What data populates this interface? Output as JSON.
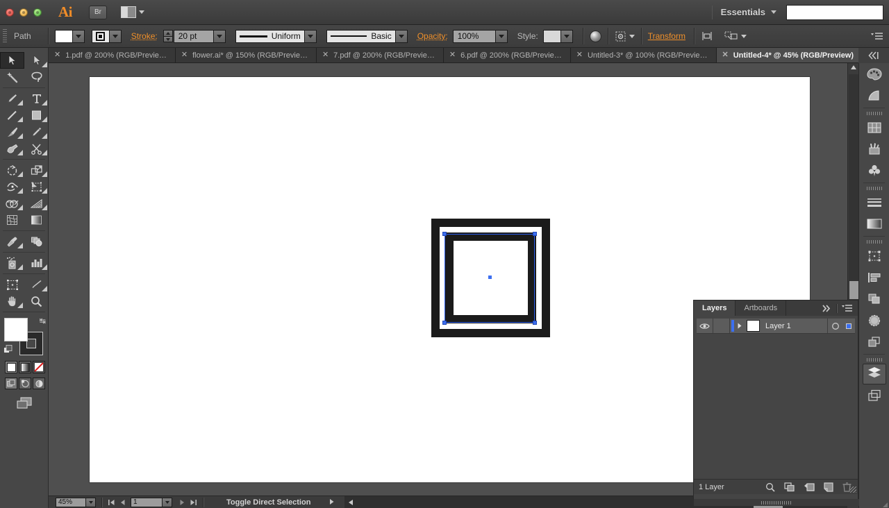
{
  "app": {
    "name": "Ai",
    "bridge_label": "Br",
    "workspace": "Essentials",
    "search_value": ""
  },
  "window_controls": [
    "close",
    "minimize",
    "zoom"
  ],
  "control_bar": {
    "object_type": "Path",
    "fill_color": "#ffffff",
    "stroke_label": "Stroke:",
    "stroke_weight": "20 pt",
    "profile": "Uniform",
    "brush": "Basic",
    "opacity_label": "Opacity:",
    "opacity_value": "100%",
    "style_label": "Style:",
    "transform_label": "Transform",
    "icons": [
      "stroke-appearance-icon",
      "opacity-appearance-icon",
      "style-swatch",
      "align-icon",
      "transform-icon",
      "isolate-icon",
      "select-similar-icon",
      "panel-menu-icon"
    ]
  },
  "tabs": [
    {
      "label": "1.pdf @ 200% (RGB/Previe…",
      "active": false
    },
    {
      "label": "flower.ai* @ 150% (RGB/Previe…",
      "active": false
    },
    {
      "label": "7.pdf @ 200% (RGB/Previe…",
      "active": false
    },
    {
      "label": "6.pdf @ 200% (RGB/Previe…",
      "active": false
    },
    {
      "label": "Untitled-3* @ 100% (RGB/Previe…",
      "active": false
    },
    {
      "label": "Untitled-4* @ 45% (RGB/Preview)",
      "active": true
    }
  ],
  "toolbar": {
    "tools": [
      {
        "name": "selection-tool",
        "selected": true,
        "flyout": false
      },
      {
        "name": "direct-selection-tool",
        "selected": false,
        "flyout": true
      },
      {
        "name": "magic-wand-tool",
        "selected": false,
        "flyout": false
      },
      {
        "name": "lasso-tool",
        "selected": false,
        "flyout": false
      },
      {
        "name": "pen-tool",
        "selected": false,
        "flyout": true
      },
      {
        "name": "type-tool",
        "selected": false,
        "flyout": true
      },
      {
        "name": "line-segment-tool",
        "selected": false,
        "flyout": true
      },
      {
        "name": "rectangle-tool",
        "selected": false,
        "flyout": true
      },
      {
        "name": "paintbrush-tool",
        "selected": false,
        "flyout": true
      },
      {
        "name": "pencil-tool",
        "selected": false,
        "flyout": true
      },
      {
        "name": "blob-brush-tool",
        "selected": false,
        "flyout": true
      },
      {
        "name": "eraser-tool",
        "selected": false,
        "flyout": true
      },
      {
        "name": "rotate-tool",
        "selected": false,
        "flyout": true
      },
      {
        "name": "scale-tool",
        "selected": false,
        "flyout": true
      },
      {
        "name": "width-tool",
        "selected": false,
        "flyout": true
      },
      {
        "name": "free-transform-tool",
        "selected": false,
        "flyout": true
      },
      {
        "name": "shape-builder-tool",
        "selected": false,
        "flyout": true
      },
      {
        "name": "perspective-grid-tool",
        "selected": false,
        "flyout": true
      },
      {
        "name": "mesh-tool",
        "selected": false,
        "flyout": false
      },
      {
        "name": "gradient-tool",
        "selected": false,
        "flyout": false
      },
      {
        "name": "eyedropper-tool",
        "selected": false,
        "flyout": true
      },
      {
        "name": "blend-tool",
        "selected": false,
        "flyout": false
      },
      {
        "name": "symbol-sprayer-tool",
        "selected": false,
        "flyout": true
      },
      {
        "name": "column-graph-tool",
        "selected": false,
        "flyout": true
      },
      {
        "name": "artboard-tool",
        "selected": false,
        "flyout": false
      },
      {
        "name": "slice-tool",
        "selected": false,
        "flyout": true
      },
      {
        "name": "hand-tool",
        "selected": false,
        "flyout": true
      },
      {
        "name": "zoom-tool",
        "selected": false,
        "flyout": false
      }
    ],
    "fill_color": "#ffffff",
    "stroke_color": "#1b1b1b",
    "fill_modes": [
      "color-mode",
      "gradient-mode",
      "none-mode"
    ],
    "draw_modes": [
      "draw-normal",
      "draw-behind",
      "draw-inside"
    ],
    "screen_mode": "screen-mode-icon"
  },
  "canvas": {
    "artwork_name": "nested-square-frame",
    "frame_color": "#1b1b1b",
    "inner_color": "#ffffff",
    "selection_color": "#3d6ff0"
  },
  "status_bar": {
    "zoom_value": "45%",
    "page_value": "1",
    "status_text": "Toggle Direct Selection"
  },
  "layers_panel": {
    "tabs": [
      {
        "label": "Layers",
        "active": true
      },
      {
        "label": "Artboards",
        "active": false
      }
    ],
    "expand_icon": "double-chevron-right-icon",
    "menu_icon": "panel-menu-icon",
    "rows": [
      {
        "name": "Layer 1",
        "visible": true,
        "locked": false,
        "selected": true,
        "thumb_color": "#ffffff"
      }
    ],
    "footer_count": "1 Layer",
    "footer_buttons": [
      "locate-object-icon",
      "make-clipping-mask-icon",
      "create-new-sublayer-icon",
      "create-new-layer-icon",
      "delete-selection-icon"
    ]
  },
  "dock": {
    "items": [
      {
        "name": "color-panel-icon",
        "selected": false
      },
      {
        "name": "color-guide-panel-icon",
        "selected": false
      },
      {
        "name": "swatches-panel-icon",
        "selected": false
      },
      {
        "name": "brushes-panel-icon",
        "selected": false
      },
      {
        "name": "symbols-panel-icon",
        "selected": false
      },
      {
        "name": "stroke-panel-icon",
        "selected": false
      },
      {
        "name": "gradient-panel-icon",
        "selected": false
      },
      {
        "name": "transform-panel-icon",
        "selected": false
      },
      {
        "name": "align-panel-icon",
        "selected": false
      },
      {
        "name": "pathfinder-panel-icon",
        "selected": false
      },
      {
        "name": "transparency-panel-icon",
        "selected": false
      },
      {
        "name": "appearance-panel-icon",
        "selected": false
      },
      {
        "name": "layers-panel-icon",
        "selected": true
      },
      {
        "name": "artboards-panel-icon",
        "selected": false
      }
    ]
  }
}
